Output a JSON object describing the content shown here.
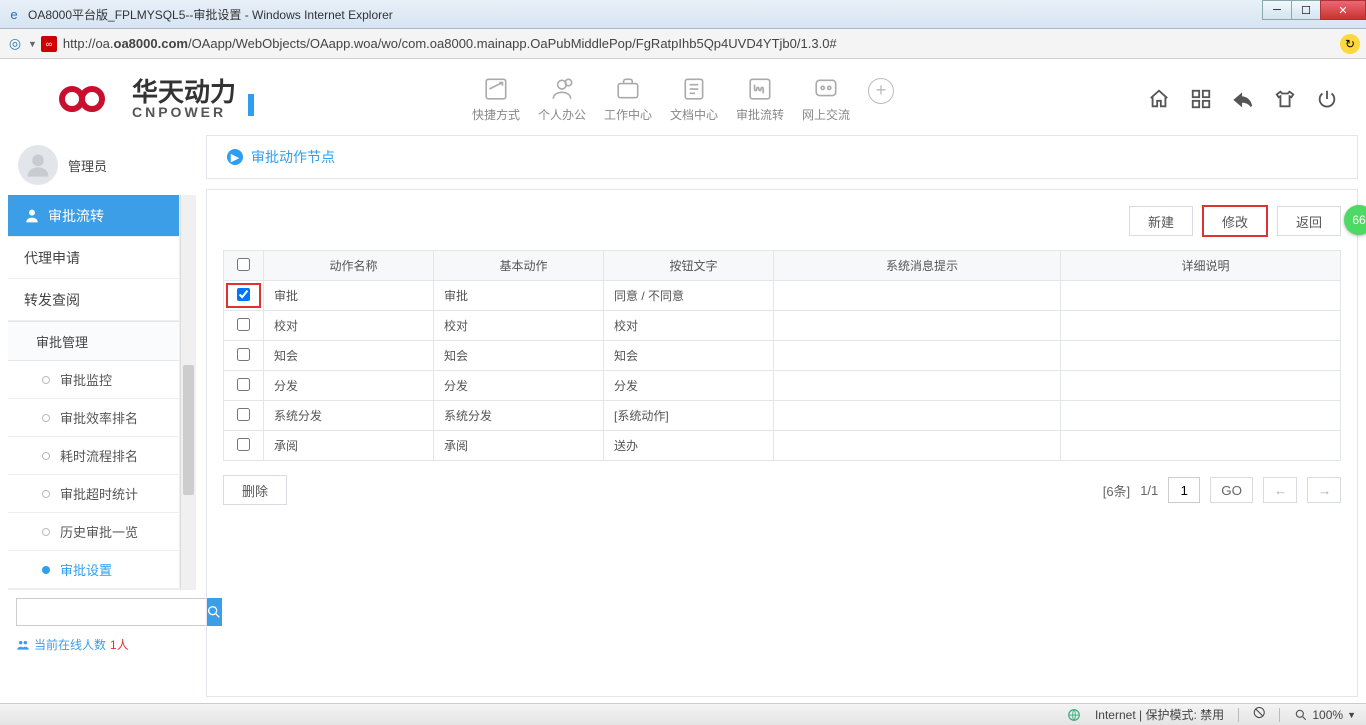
{
  "window": {
    "title": "OA8000平台版_FPLMYSQL5--审批设置 - Windows Internet Explorer",
    "url_prefix": "http://oa.",
    "url_bold": "oa8000.com",
    "url_rest": "/OAapp/WebObjects/OAapp.woa/wo/com.oa8000.mainapp.OaPubMiddlePop/FgRatpIhb5Qp4UVD4YTjb0/1.3.0#"
  },
  "logo": {
    "cn": "华天动力",
    "en": "CNPOWER"
  },
  "topnav": [
    {
      "label": "快捷方式"
    },
    {
      "label": "个人办公"
    },
    {
      "label": "工作中心"
    },
    {
      "label": "文档中心"
    },
    {
      "label": "审批流转"
    },
    {
      "label": "网上交流"
    }
  ],
  "user": {
    "name": "管理员"
  },
  "sidebar": {
    "active_section": "审批流转",
    "items": [
      "代理申请",
      "转发查阅"
    ],
    "group_head": "审批管理",
    "subs": [
      "审批监控",
      "审批效率排名",
      "耗时流程排名",
      "审批超时统计",
      "历史审批一览",
      "审批设置"
    ],
    "current_sub_index": 5,
    "online_label": "当前在线人数",
    "online_count": "1人"
  },
  "panel": {
    "title": "审批动作节点",
    "buttons": {
      "new": "新建",
      "edit": "修改",
      "back": "返回"
    },
    "columns": [
      "动作名称",
      "基本动作",
      "按钮文字",
      "系统消息提示",
      "详细说明"
    ],
    "rows": [
      {
        "checked": true,
        "highlight": true,
        "c": [
          "审批",
          "审批",
          "同意 / 不同意",
          "",
          ""
        ]
      },
      {
        "checked": false,
        "highlight": false,
        "c": [
          "校对",
          "校对",
          "校对",
          "",
          ""
        ]
      },
      {
        "checked": false,
        "highlight": false,
        "c": [
          "知会",
          "知会",
          "知会",
          "",
          ""
        ]
      },
      {
        "checked": false,
        "highlight": false,
        "c": [
          "分发",
          "分发",
          "分发",
          "",
          ""
        ]
      },
      {
        "checked": false,
        "highlight": false,
        "c": [
          "系统分发",
          "系统分发",
          "[系统动作]",
          "",
          ""
        ]
      },
      {
        "checked": false,
        "highlight": false,
        "c": [
          "承阅",
          "承阅",
          "送办",
          "",
          ""
        ]
      }
    ],
    "delete": "删除",
    "total": "[6条]",
    "page": "1/1",
    "page_value": "1",
    "go": "GO"
  },
  "status": {
    "zone": "Internet | 保护模式: 禁用",
    "zoom": "100%"
  },
  "badge": "66"
}
